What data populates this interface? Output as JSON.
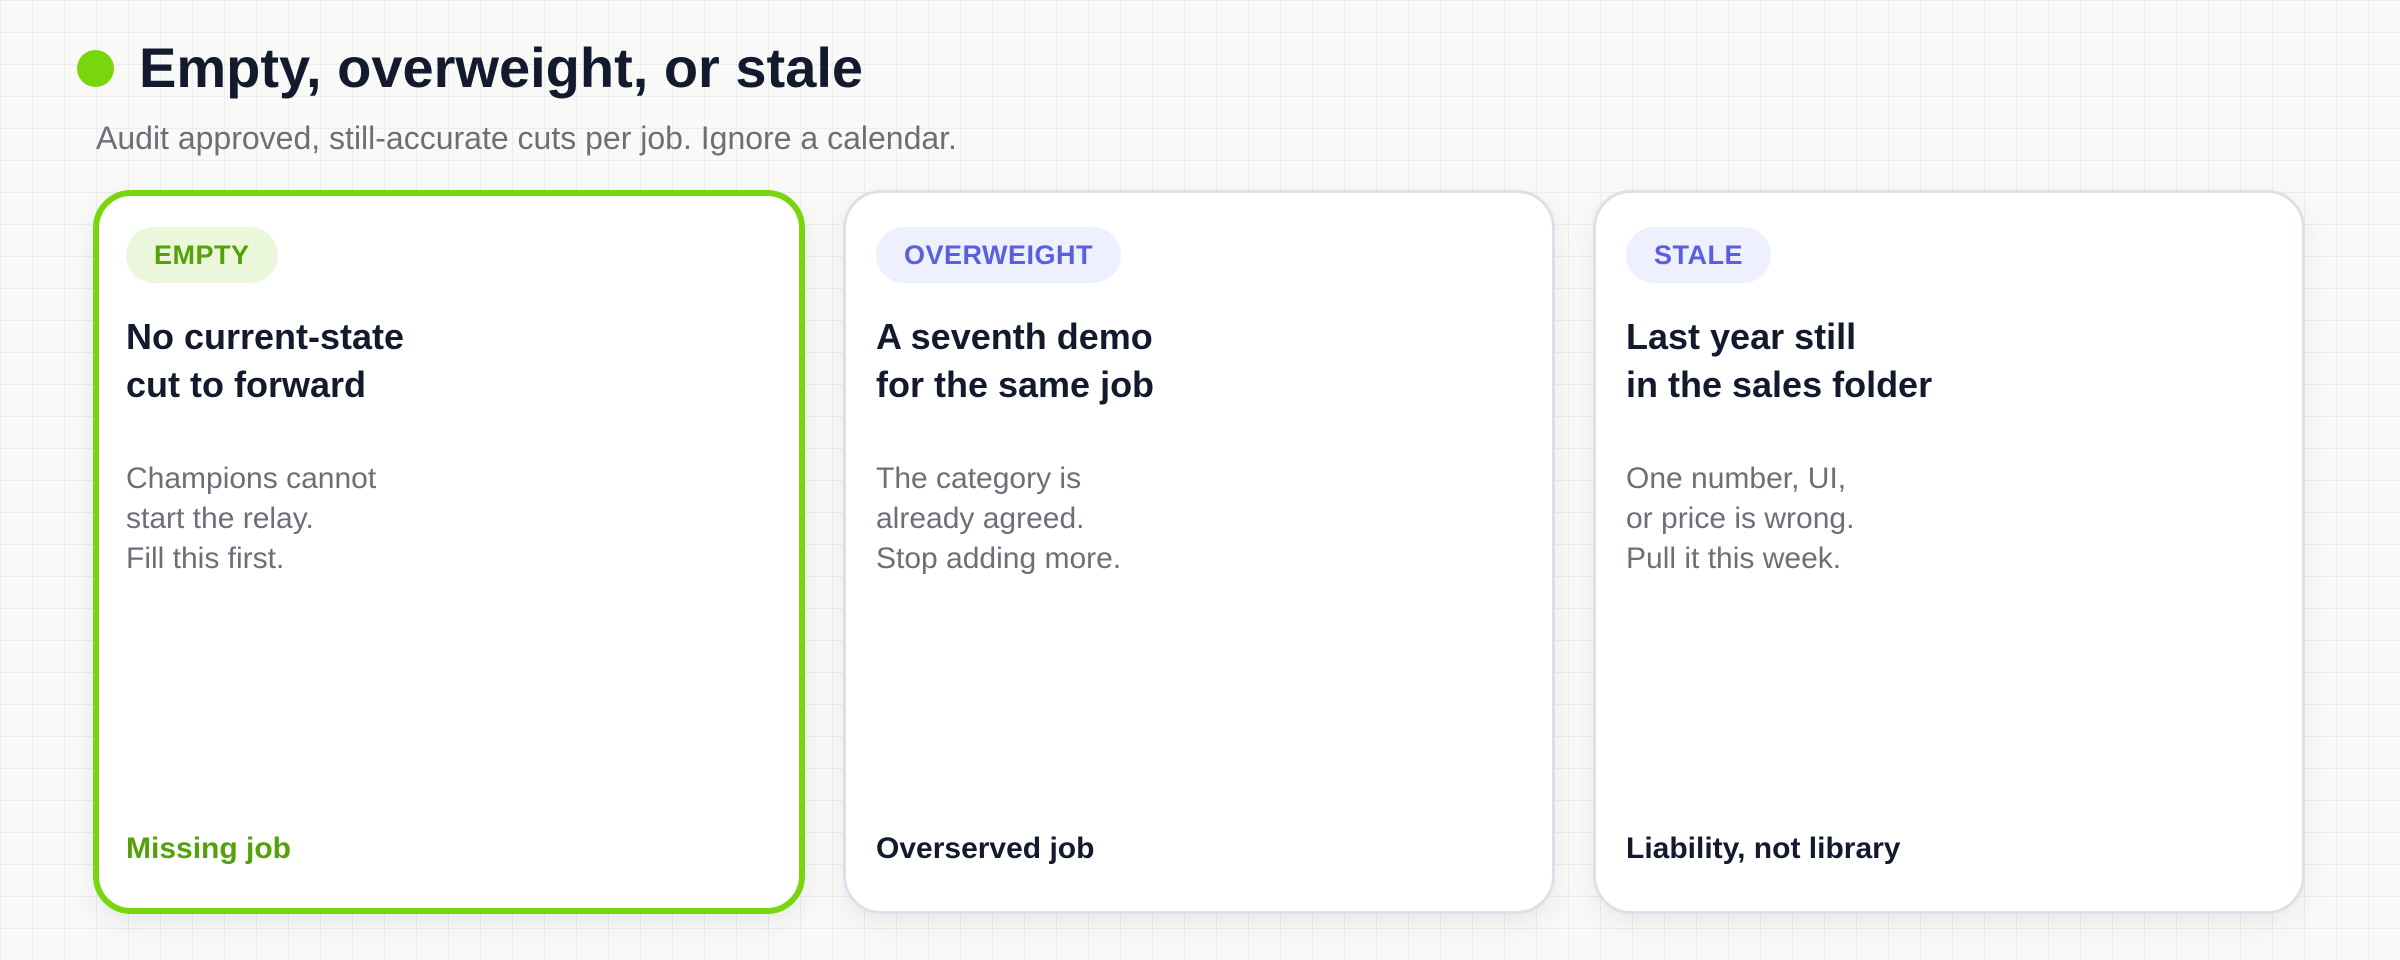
{
  "header": {
    "title": "Empty, overweight, or stale",
    "subtitle": "Audit approved, still-accurate cuts per job. Ignore a calendar.",
    "dot_color": "#79d60c"
  },
  "cards": [
    {
      "badge": "EMPTY",
      "title": "No current-state\ncut to forward",
      "body": "Champions cannot\nstart the relay.\nFill this first.",
      "footer": "Missing job",
      "highlighted": true,
      "accent_color": "#79d60c"
    },
    {
      "badge": "OVERWEIGHT",
      "title": "A seventh demo\nfor the same job",
      "body": "The category is\nalready agreed.\nStop adding more.",
      "footer": "Overserved job",
      "highlighted": false,
      "accent_color": "#5a5fe0"
    },
    {
      "badge": "STALE",
      "title": "Last year still\nin the sales folder",
      "body": "One number, UI,\nor price is wrong.\nPull it this week.",
      "footer": "Liability, not library",
      "highlighted": false,
      "accent_color": "#5a5fe0"
    }
  ]
}
